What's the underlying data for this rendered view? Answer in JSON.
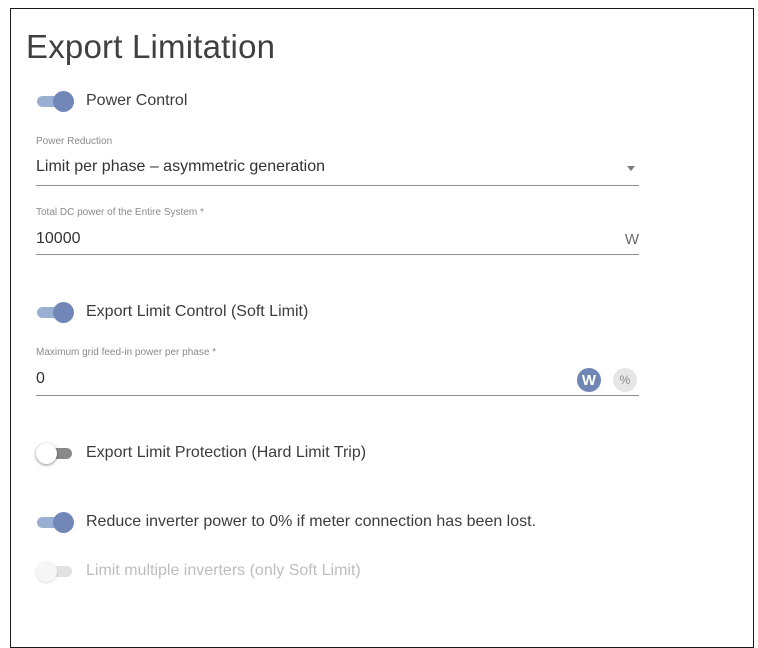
{
  "title": "Export Limitation",
  "power_control": {
    "label": "Power Control",
    "enabled": true
  },
  "power_reduction": {
    "label": "Power Reduction",
    "value": "Limit per phase – asymmetric generation"
  },
  "total_dc_power": {
    "label": "Total DC power of the Entire System *",
    "value": "10000",
    "unit": "W"
  },
  "export_limit_control": {
    "label": "Export Limit Control (Soft Limit)",
    "enabled": true
  },
  "max_feed_in": {
    "label": "Maximum grid feed-in power per phase *",
    "value": "0",
    "unit_w": "W",
    "unit_pct": "%",
    "selected_unit": "W"
  },
  "export_limit_protection": {
    "label": "Export Limit Protection (Hard Limit Trip)",
    "enabled": false
  },
  "reduce_on_meter_loss": {
    "label": "Reduce inverter power to 0% if meter connection has been lost.",
    "enabled": true
  },
  "limit_multiple_inverters": {
    "label": "Limit multiple inverters (only Soft Limit)",
    "enabled": false,
    "disabled": true
  },
  "colors": {
    "accent": "#7187b7",
    "accent_track": "#9ab0d2",
    "text": "#3c3c3c",
    "muted": "#8a8a8a",
    "disabled_text": "#bdbdbd"
  }
}
